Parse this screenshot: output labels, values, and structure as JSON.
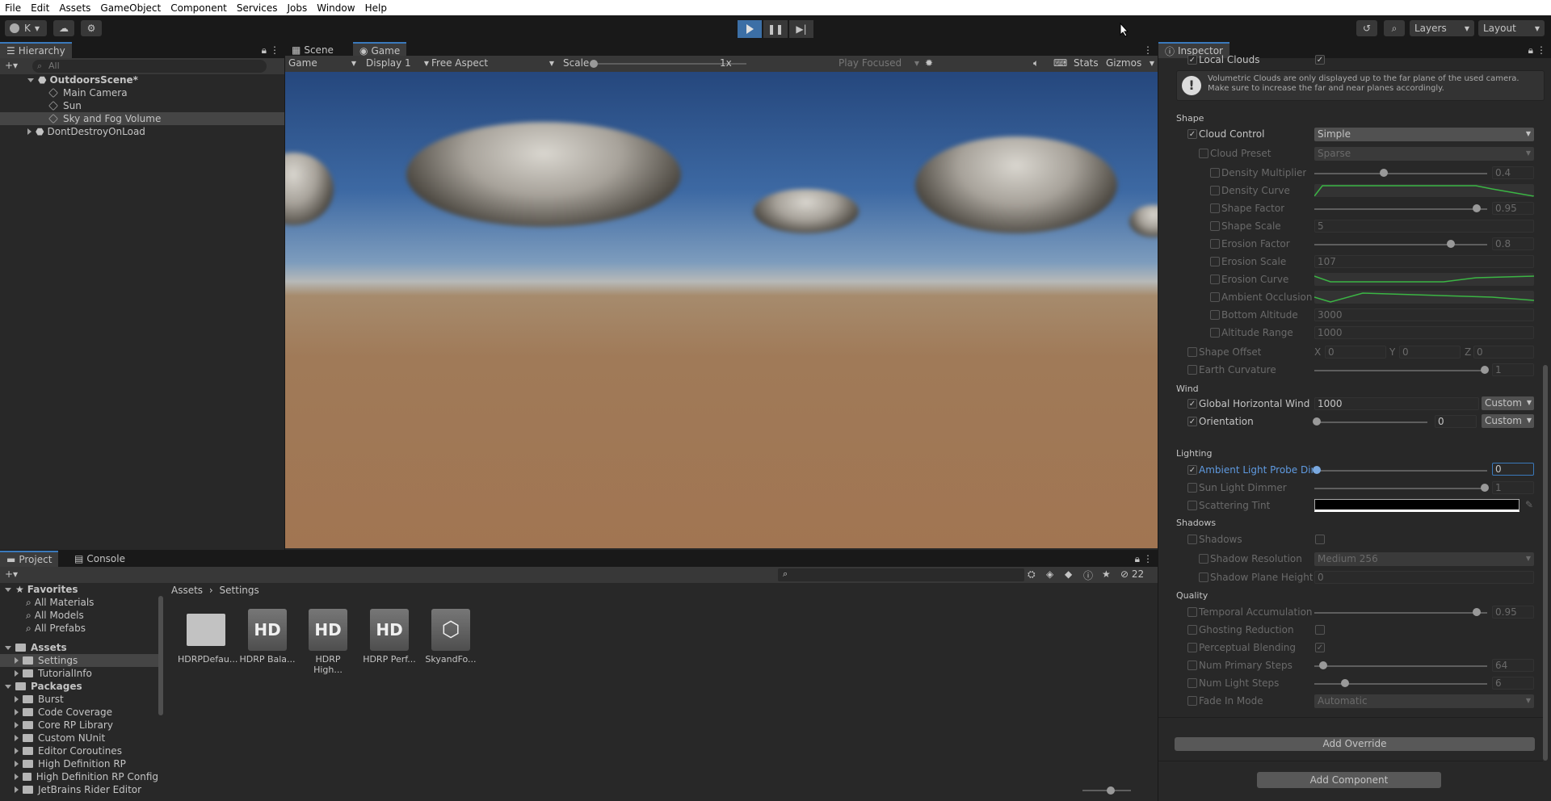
{
  "menu": [
    "File",
    "Edit",
    "Assets",
    "GameObject",
    "Component",
    "Services",
    "Jobs",
    "Window",
    "Help"
  ],
  "toolbar": {
    "account": "K",
    "layers": "Layers",
    "layout": "Layout"
  },
  "hierarchy": {
    "tab": "Hierarchy",
    "search_placeholder": "All",
    "items": [
      {
        "label": "OutdoorsScene*",
        "type": "scene"
      },
      {
        "label": "Main Camera",
        "type": "object"
      },
      {
        "label": "Sun",
        "type": "object"
      },
      {
        "label": "Sky and Fog Volume",
        "type": "object",
        "selected": true
      },
      {
        "label": "DontDestroyOnLoad",
        "type": "scene"
      }
    ]
  },
  "gameview": {
    "tabs": [
      "Scene",
      "Game"
    ],
    "game_dropdown": "Game",
    "display": "Display 1",
    "aspect": "Free Aspect",
    "scale_label": "Scale",
    "scale_value": "1x",
    "play_focused": "Play Focused",
    "stats": "Stats",
    "gizmos": "Gizmos"
  },
  "project": {
    "tabs": [
      "Project",
      "Console"
    ],
    "favorites_label": "Favorites",
    "favorites": [
      "All Materials",
      "All Models",
      "All Prefabs"
    ],
    "assets_label": "Assets",
    "assets_children": [
      "Settings",
      "TutorialInfo"
    ],
    "packages_label": "Packages",
    "packages": [
      "Burst",
      "Code Coverage",
      "Core RP Library",
      "Custom NUnit",
      "Editor Coroutines",
      "High Definition RP",
      "High Definition RP Config",
      "JetBrains Rider Editor"
    ],
    "breadcrumb": [
      "Assets",
      "Settings"
    ],
    "hidden_count": "22",
    "files": [
      {
        "label": "HDRPDefau...",
        "icon": "folder"
      },
      {
        "label": "HDRP Bala...",
        "icon": "hd"
      },
      {
        "label": "HDRP High...",
        "icon": "hd"
      },
      {
        "label": "HDRP Perf...",
        "icon": "hd"
      },
      {
        "label": "SkyandFo...",
        "icon": "cube"
      }
    ],
    "hd_text": "HD"
  },
  "inspector": {
    "tab": "Inspector",
    "local_clouds": "Local Clouds",
    "help_text": "Volumetric Clouds are only displayed up to the far plane of the used camera. Make sure to increase the far and near planes accordingly.",
    "sections": {
      "shape": "Shape",
      "wind": "Wind",
      "lighting": "Lighting",
      "shadows": "Shadows",
      "quality": "Quality"
    },
    "cloud_control": {
      "label": "Cloud Control",
      "value": "Simple"
    },
    "cloud_preset": {
      "label": "Cloud Preset",
      "value": "Sparse"
    },
    "density_multiplier": {
      "label": "Density Multiplier",
      "value": "0.4",
      "fraction": 0.4
    },
    "density_curve": "Density Curve",
    "shape_factor": {
      "label": "Shape Factor",
      "value": "0.95",
      "fraction": 0.95
    },
    "shape_scale": {
      "label": "Shape Scale",
      "value": "5"
    },
    "erosion_factor": {
      "label": "Erosion Factor",
      "value": "0.8",
      "fraction": 0.8
    },
    "erosion_scale": {
      "label": "Erosion Scale",
      "value": "107"
    },
    "erosion_curve": "Erosion Curve",
    "ambient_occlusion": "Ambient Occlusion C",
    "bottom_altitude": {
      "label": "Bottom Altitude",
      "value": "3000"
    },
    "altitude_range": {
      "label": "Altitude Range",
      "value": "1000"
    },
    "shape_offset": {
      "label": "Shape Offset",
      "x": "0",
      "y": "0",
      "z": "0"
    },
    "earth_curvature": {
      "label": "Earth Curvature",
      "value": "1",
      "fraction": 1
    },
    "global_wind": {
      "label": "Global Horizontal Wind Sp",
      "value": "1000",
      "mode": "Custom"
    },
    "orientation": {
      "label": "Orientation",
      "value": "0",
      "mode": "Custom",
      "fraction": 0
    },
    "ambient_light_probe": {
      "label": "Ambient Light Probe Dimm",
      "value": "0",
      "fraction": 0
    },
    "sun_light_dimmer": {
      "label": "Sun Light Dimmer",
      "value": "1",
      "fraction": 1
    },
    "scattering_tint": "Scattering Tint",
    "shadows": "Shadows",
    "shadow_resolution": {
      "label": "Shadow Resolution",
      "value": "Medium 256"
    },
    "shadow_plane_height": {
      "label": "Shadow Plane Height C",
      "value": "0"
    },
    "temporal_accumulation": {
      "label": "Temporal Accumulation F",
      "value": "0.95",
      "fraction": 0.95
    },
    "ghosting_reduction": "Ghosting Reduction",
    "perceptual_blending": "Perceptual Blending",
    "num_primary_steps": {
      "label": "Num Primary Steps",
      "value": "64",
      "fraction": 0.04
    },
    "num_light_steps": {
      "label": "Num Light Steps",
      "value": "6",
      "fraction": 0.17
    },
    "fade_in_mode": {
      "label": "Fade In Mode",
      "value": "Automatic"
    },
    "add_override": "Add Override",
    "add_component": "Add Component"
  },
  "labels": {
    "X": "X",
    "Y": "Y",
    "Z": "Z"
  },
  "colors": {
    "accent": "#3a79bb",
    "highlight_text": "#5f9ae0",
    "curve_green": "#3bb544"
  }
}
